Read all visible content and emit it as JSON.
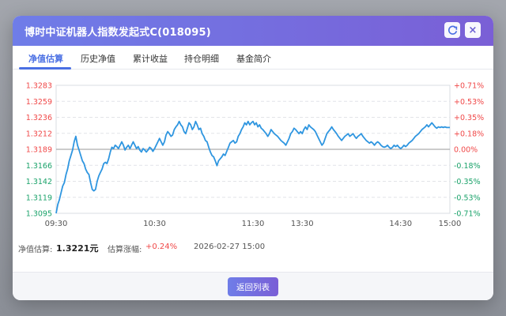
{
  "modal": {
    "title": "博时中证机器人指数发起式C(018095)",
    "close_label": "×",
    "refresh_icon": "refresh-icon"
  },
  "tabs": [
    {
      "label": "净值估算",
      "active": true
    },
    {
      "label": "历史净值",
      "active": false
    },
    {
      "label": "累计收益",
      "active": false
    },
    {
      "label": "持仓明细",
      "active": false
    },
    {
      "label": "基金简介",
      "active": false
    }
  ],
  "info": {
    "nav_label": "净值估算:",
    "nav_value": "1.3221元",
    "change_label": "估算涨幅:",
    "change_value": "+0.24%",
    "timestamp": "2026-02-27 15:00"
  },
  "footer": {
    "back_label": "返回列表"
  },
  "colors": {
    "up": "#f04848",
    "down": "#1aa26a",
    "line": "#2f96e0",
    "accent": "#4a6fe3"
  },
  "chart_data": {
    "type": "line",
    "base": 1.3189,
    "ylim": [
      1.3095,
      1.3283
    ],
    "left_ticks": [
      "1.3283",
      "1.3259",
      "1.3236",
      "1.3212",
      "1.3189",
      "1.3166",
      "1.3142",
      "1.3119",
      "1.3095"
    ],
    "right_ticks": [
      "+0.71%",
      "+0.53%",
      "+0.35%",
      "+0.18%",
      "0.00%",
      "-0.18%",
      "-0.35%",
      "-0.53%",
      "-0.71%"
    ],
    "x_labels": [
      {
        "label": "09:30",
        "minute": 0
      },
      {
        "label": "10:30",
        "minute": 60
      },
      {
        "label": "11:30",
        "minute": 120
      },
      {
        "label": "13:30",
        "minute": 150
      },
      {
        "label": "14:30",
        "minute": 210
      },
      {
        "label": "15:00",
        "minute": 240
      }
    ],
    "total_minutes": 240,
    "series": [
      {
        "points": [
          [
            0,
            1.3095
          ],
          [
            1,
            1.3108
          ],
          [
            2,
            1.3115
          ],
          [
            3,
            1.3125
          ],
          [
            4,
            1.3135
          ],
          [
            5,
            1.314
          ],
          [
            6,
            1.3152
          ],
          [
            7,
            1.316
          ],
          [
            8,
            1.3172
          ],
          [
            9,
            1.318
          ],
          [
            10,
            1.3188
          ],
          [
            11,
            1.32
          ],
          [
            12,
            1.3208
          ],
          [
            13,
            1.3195
          ],
          [
            14,
            1.3188
          ],
          [
            15,
            1.318
          ],
          [
            16,
            1.3172
          ],
          [
            17,
            1.3168
          ],
          [
            18,
            1.316
          ],
          [
            19,
            1.3155
          ],
          [
            20,
            1.3152
          ],
          [
            21,
            1.314
          ],
          [
            22,
            1.313
          ],
          [
            23,
            1.3128
          ],
          [
            24,
            1.313
          ],
          [
            25,
            1.3142
          ],
          [
            26,
            1.315
          ],
          [
            27,
            1.3155
          ],
          [
            28,
            1.316
          ],
          [
            29,
            1.3168
          ],
          [
            30,
            1.317
          ],
          [
            31,
            1.3168
          ],
          [
            32,
            1.3175
          ],
          [
            33,
            1.3185
          ],
          [
            34,
            1.3192
          ],
          [
            35,
            1.319
          ],
          [
            36,
            1.3195
          ],
          [
            37,
            1.3193
          ],
          [
            38,
            1.319
          ],
          [
            39,
            1.3195
          ],
          [
            40,
            1.32
          ],
          [
            41,
            1.3195
          ],
          [
            42,
            1.3188
          ],
          [
            43,
            1.3192
          ],
          [
            44,
            1.3195
          ],
          [
            45,
            1.319
          ],
          [
            46,
            1.3195
          ],
          [
            47,
            1.32
          ],
          [
            48,
            1.3195
          ],
          [
            49,
            1.319
          ],
          [
            50,
            1.3193
          ],
          [
            51,
            1.3188
          ],
          [
            52,
            1.3185
          ],
          [
            53,
            1.319
          ],
          [
            54,
            1.3188
          ],
          [
            55,
            1.3185
          ],
          [
            56,
            1.3188
          ],
          [
            57,
            1.3192
          ],
          [
            58,
            1.319
          ],
          [
            59,
            1.3186
          ],
          [
            60,
            1.319
          ],
          [
            61,
            1.3195
          ],
          [
            62,
            1.32
          ],
          [
            63,
            1.3205
          ],
          [
            64,
            1.32
          ],
          [
            65,
            1.3195
          ],
          [
            66,
            1.32
          ],
          [
            67,
            1.321
          ],
          [
            68,
            1.3215
          ],
          [
            69,
            1.3212
          ],
          [
            70,
            1.3208
          ],
          [
            71,
            1.321
          ],
          [
            72,
            1.3218
          ],
          [
            73,
            1.3222
          ],
          [
            74,
            1.3225
          ],
          [
            75,
            1.323
          ],
          [
            76,
            1.3225
          ],
          [
            77,
            1.3222
          ],
          [
            78,
            1.3215
          ],
          [
            79,
            1.3212
          ],
          [
            80,
            1.322
          ],
          [
            81,
            1.3228
          ],
          [
            82,
            1.3225
          ],
          [
            83,
            1.3218
          ],
          [
            84,
            1.3222
          ],
          [
            85,
            1.323
          ],
          [
            86,
            1.3225
          ],
          [
            87,
            1.3218
          ],
          [
            88,
            1.322
          ],
          [
            89,
            1.3212
          ],
          [
            90,
            1.3208
          ],
          [
            91,
            1.3202
          ],
          [
            92,
            1.32
          ],
          [
            93,
            1.3192
          ],
          [
            94,
            1.3185
          ],
          [
            95,
            1.318
          ],
          [
            96,
            1.3178
          ],
          [
            97,
            1.3172
          ],
          [
            98,
            1.3165
          ],
          [
            99,
            1.3172
          ],
          [
            100,
            1.3175
          ],
          [
            101,
            1.3178
          ],
          [
            102,
            1.3182
          ],
          [
            103,
            1.318
          ],
          [
            104,
            1.3186
          ],
          [
            105,
            1.3192
          ],
          [
            106,
            1.3198
          ],
          [
            107,
            1.32
          ],
          [
            108,
            1.3202
          ],
          [
            109,
            1.3198
          ],
          [
            110,
            1.32
          ],
          [
            111,
            1.3208
          ],
          [
            112,
            1.3212
          ],
          [
            113,
            1.3218
          ],
          [
            114,
            1.3222
          ],
          [
            115,
            1.3228
          ],
          [
            116,
            1.3225
          ],
          [
            117,
            1.323
          ],
          [
            118,
            1.3225
          ],
          [
            119,
            1.3228
          ],
          [
            120,
            1.323
          ],
          [
            121,
            1.3225
          ],
          [
            122,
            1.3228
          ],
          [
            123,
            1.3222
          ],
          [
            124,
            1.3225
          ],
          [
            125,
            1.322
          ],
          [
            126,
            1.3218
          ],
          [
            127,
            1.3215
          ],
          [
            128,
            1.3212
          ],
          [
            129,
            1.3208
          ],
          [
            130,
            1.3212
          ],
          [
            131,
            1.3218
          ],
          [
            132,
            1.3215
          ],
          [
            133,
            1.3212
          ],
          [
            134,
            1.321
          ],
          [
            135,
            1.3208
          ],
          [
            136,
            1.3205
          ],
          [
            137,
            1.3202
          ],
          [
            138,
            1.32
          ],
          [
            139,
            1.3198
          ],
          [
            140,
            1.3195
          ],
          [
            141,
            1.32
          ],
          [
            142,
            1.3205
          ],
          [
            143,
            1.3212
          ],
          [
            144,
            1.3215
          ],
          [
            145,
            1.322
          ],
          [
            146,
            1.3218
          ],
          [
            147,
            1.3215
          ],
          [
            148,
            1.3212
          ],
          [
            149,
            1.3215
          ],
          [
            150,
            1.3212
          ],
          [
            151,
            1.3218
          ],
          [
            152,
            1.3222
          ],
          [
            153,
            1.3218
          ],
          [
            154,
            1.3225
          ],
          [
            155,
            1.3222
          ],
          [
            156,
            1.322
          ],
          [
            157,
            1.3218
          ],
          [
            158,
            1.3215
          ],
          [
            159,
            1.321
          ],
          [
            160,
            1.3205
          ],
          [
            161,
            1.32
          ],
          [
            162,
            1.3195
          ],
          [
            163,
            1.3198
          ],
          [
            164,
            1.3205
          ],
          [
            165,
            1.3212
          ],
          [
            166,
            1.3215
          ],
          [
            167,
            1.3218
          ],
          [
            168,
            1.3222
          ],
          [
            169,
            1.3218
          ],
          [
            170,
            1.3215
          ],
          [
            171,
            1.3212
          ],
          [
            172,
            1.3208
          ],
          [
            173,
            1.3205
          ],
          [
            174,
            1.3202
          ],
          [
            175,
            1.3205
          ],
          [
            176,
            1.3208
          ],
          [
            177,
            1.321
          ],
          [
            178,
            1.3212
          ],
          [
            179,
            1.3208
          ],
          [
            180,
            1.321
          ],
          [
            181,
            1.3212
          ],
          [
            182,
            1.3208
          ],
          [
            183,
            1.3205
          ],
          [
            184,
            1.3208
          ],
          [
            185,
            1.321
          ],
          [
            186,
            1.3212
          ],
          [
            187,
            1.3208
          ],
          [
            188,
            1.3205
          ],
          [
            189,
            1.3202
          ],
          [
            190,
            1.32
          ],
          [
            191,
            1.3198
          ],
          [
            192,
            1.32
          ],
          [
            193,
            1.3198
          ],
          [
            194,
            1.3195
          ],
          [
            195,
            1.3198
          ],
          [
            196,
            1.32
          ],
          [
            197,
            1.3198
          ],
          [
            198,
            1.3195
          ],
          [
            199,
            1.3193
          ],
          [
            200,
            1.3192
          ],
          [
            201,
            1.3193
          ],
          [
            202,
            1.3195
          ],
          [
            203,
            1.3192
          ],
          [
            204,
            1.319
          ],
          [
            205,
            1.3192
          ],
          [
            206,
            1.3195
          ],
          [
            207,
            1.3193
          ],
          [
            208,
            1.3195
          ],
          [
            209,
            1.3192
          ],
          [
            210,
            1.319
          ],
          [
            211,
            1.3192
          ],
          [
            212,
            1.3195
          ],
          [
            213,
            1.3193
          ],
          [
            214,
            1.3195
          ],
          [
            215,
            1.3198
          ],
          [
            216,
            1.32
          ],
          [
            217,
            1.3202
          ],
          [
            218,
            1.3205
          ],
          [
            219,
            1.3208
          ],
          [
            220,
            1.321
          ],
          [
            221,
            1.3212
          ],
          [
            222,
            1.3215
          ],
          [
            223,
            1.3218
          ],
          [
            224,
            1.322
          ],
          [
            225,
            1.3222
          ],
          [
            226,
            1.3225
          ],
          [
            227,
            1.3222
          ],
          [
            228,
            1.3225
          ],
          [
            229,
            1.3228
          ],
          [
            230,
            1.3225
          ],
          [
            231,
            1.3222
          ],
          [
            232,
            1.322
          ],
          [
            233,
            1.3222
          ],
          [
            234,
            1.3221
          ],
          [
            235,
            1.3222
          ],
          [
            236,
            1.3221
          ],
          [
            237,
            1.3222
          ],
          [
            238,
            1.3221
          ],
          [
            239,
            1.3221
          ],
          [
            240,
            1.3221
          ]
        ]
      }
    ]
  }
}
